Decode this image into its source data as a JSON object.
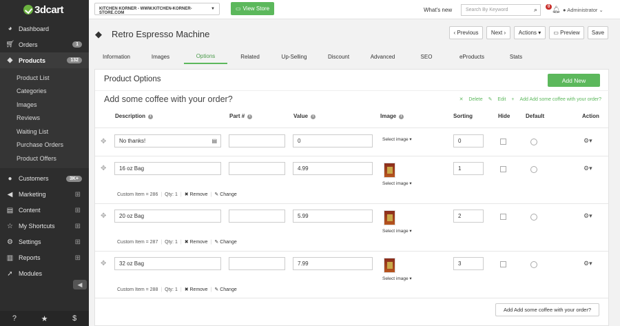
{
  "sidebar": {
    "logo": "3dcart",
    "items": [
      {
        "label": "Dashboard",
        "icon": "dashboard-icon"
      },
      {
        "label": "Orders",
        "icon": "cart-icon",
        "badge": "1"
      },
      {
        "label": "Products",
        "icon": "tag-icon",
        "badge": "132"
      }
    ],
    "sub_items": [
      "Product List",
      "Categories",
      "Images",
      "Reviews",
      "Waiting List",
      "Purchase Orders",
      "Product Offers"
    ],
    "lower_items": [
      {
        "label": "Customers",
        "icon": "users-icon",
        "badge": "3K+"
      },
      {
        "label": "Marketing",
        "icon": "megaphone-icon"
      },
      {
        "label": "Content",
        "icon": "file-icon"
      },
      {
        "label": "My Shortcuts",
        "icon": "star-icon"
      },
      {
        "label": "Settings",
        "icon": "gears-icon"
      },
      {
        "label": "Reports",
        "icon": "bar-chart-icon"
      },
      {
        "label": "Modules",
        "icon": "rocket-icon"
      }
    ],
    "bottom_icons": [
      "help-icon",
      "star-icon",
      "dollar-icon"
    ]
  },
  "topbar": {
    "store": "KITCHEN KORNER - WWW.KITCHEN-KORNER-STORE.COM",
    "view_store": "View Store",
    "whats_new": "What's new",
    "search_placeholder": "Search By Keyword",
    "notifications": "0",
    "admin": "Administrator"
  },
  "page": {
    "title": "Retro Espresso Machine",
    "buttons": {
      "previous": "Previous",
      "next": "Next",
      "actions": "Actions",
      "preview": "Preview",
      "save": "Save"
    },
    "tabs": [
      "Information",
      "Images",
      "Options",
      "Related",
      "Up-Selling",
      "Discount",
      "Advanced",
      "SEO",
      "eProducts",
      "Stats"
    ],
    "active_tab": "Options"
  },
  "options": {
    "section_title": "Product Options",
    "add_new": "Add New",
    "group_title": "Add some coffee with your order?",
    "group_actions": {
      "delete": "Delete",
      "edit": "Edit",
      "add": "Add Add some coffee with your order?"
    },
    "columns": [
      "Description",
      "Part #",
      "Value",
      "Image",
      "Sorting",
      "Hide",
      "Default",
      "Action"
    ],
    "select_image": "Select image",
    "rows": [
      {
        "description": "No thanks!",
        "part": "",
        "value": "0",
        "sorting": "0"
      },
      {
        "description": "16 oz Bag",
        "part": "",
        "value": "4.99",
        "sorting": "1",
        "custom": "Custom Item = 286",
        "qty": "Qty: 1",
        "remove": "Remove",
        "change": "Change"
      },
      {
        "description": "20 oz Bag",
        "part": "",
        "value": "5.99",
        "sorting": "2",
        "custom": "Custom Item = 287",
        "qty": "Qty: 1",
        "remove": "Remove",
        "change": "Change"
      },
      {
        "description": "32 oz Bag",
        "part": "",
        "value": "7.99",
        "sorting": "3",
        "custom": "Custom Item = 288",
        "qty": "Qty: 1",
        "remove": "Remove",
        "change": "Change"
      }
    ],
    "footer_button": "Add Add some coffee with your order?"
  }
}
